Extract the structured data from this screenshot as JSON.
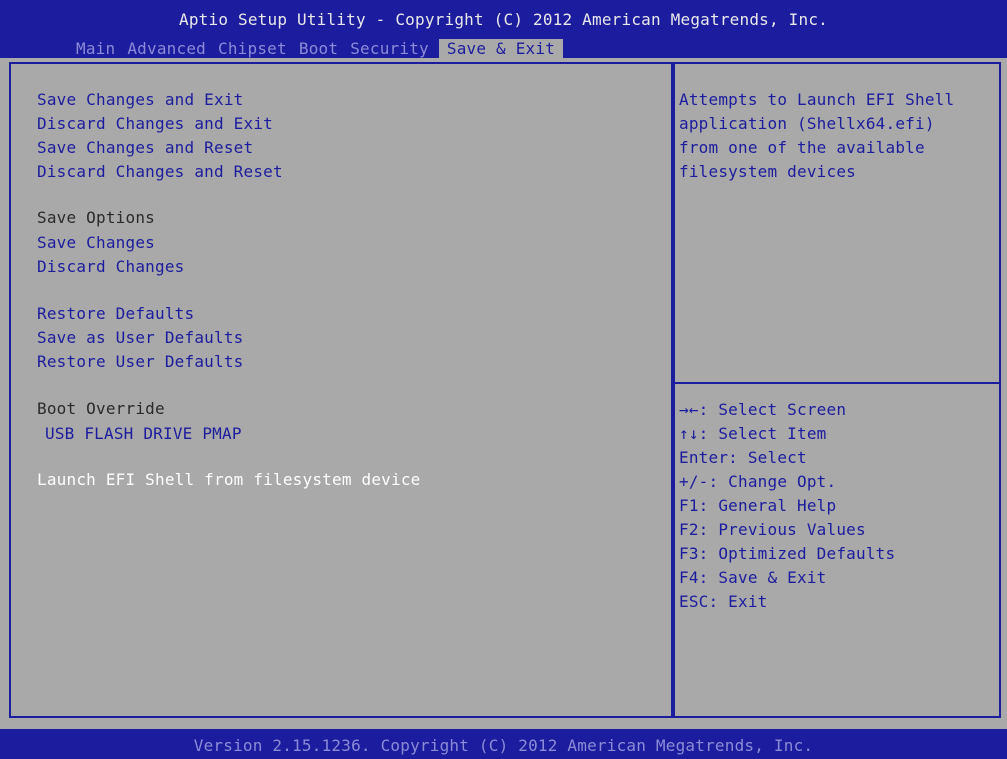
{
  "header": {
    "title": "Aptio Setup Utility - Copyright (C) 2012 American Megatrends, Inc.",
    "tabs": [
      "Main",
      "Advanced",
      "Chipset",
      "Boot",
      "Security",
      "Save & Exit"
    ],
    "active_tab": "Save & Exit"
  },
  "menu": {
    "save_changes_and_exit": "Save Changes and Exit",
    "discard_changes_and_exit": "Discard Changes and Exit",
    "save_changes_and_reset": "Save Changes and Reset",
    "discard_changes_and_reset": "Discard Changes and Reset",
    "save_options_heading": "Save Options",
    "save_changes": "Save Changes",
    "discard_changes": "Discard Changes",
    "restore_defaults": "Restore Defaults",
    "save_as_user_defaults": "Save as User Defaults",
    "restore_user_defaults": "Restore User Defaults",
    "boot_override_heading": "Boot Override",
    "usb_flash_drive": "USB FLASH DRIVE PMAP",
    "launch_efi_shell": "Launch EFI Shell from filesystem device"
  },
  "help": {
    "lines": [
      "Attempts to Launch EFI Shell",
      "application (Shellx64.efi)",
      "from one of the available",
      "filesystem devices"
    ],
    "keys": [
      "→←: Select Screen",
      "↑↓: Select Item",
      "Enter: Select",
      "+/-: Change Opt.",
      "F1: General Help",
      "F2: Previous Values",
      "F3: Optimized Defaults",
      "F4: Save & Exit",
      "ESC: Exit"
    ]
  },
  "footer": {
    "version": "Version 2.15.1236. Copyright (C) 2012 American Megatrends, Inc."
  },
  "colors": {
    "bios_blue": "#1c1c9e",
    "panel_gray": "#a9a9a9",
    "selected_text": "#ffffff"
  }
}
